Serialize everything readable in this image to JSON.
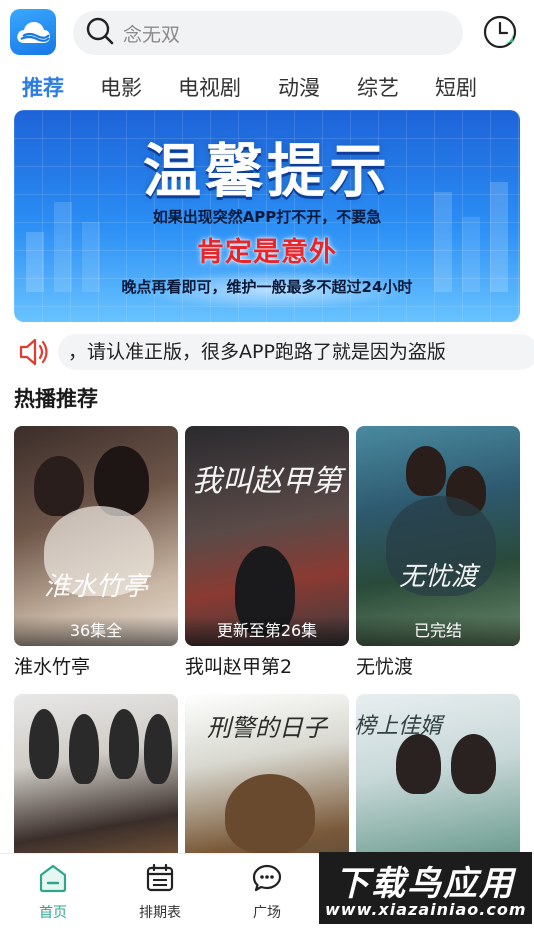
{
  "header": {
    "logo_icon": "cloud-logo-icon",
    "search": {
      "value": "念无双",
      "icon": "search-icon"
    },
    "history_icon": "clock-icon"
  },
  "tabs": [
    {
      "label": "推荐",
      "active": true
    },
    {
      "label": "电影",
      "active": false
    },
    {
      "label": "电视剧",
      "active": false
    },
    {
      "label": "动漫",
      "active": false
    },
    {
      "label": "综艺",
      "active": false
    },
    {
      "label": "短剧",
      "active": false
    }
  ],
  "banner": {
    "title": "温馨提示",
    "line1": "如果出现突然APP打不开，不要急",
    "line2": "肯定是意外",
    "line3": "晚点再看即可，维护一般最多不超过24小时"
  },
  "notice": {
    "icon": "speaker-icon",
    "text": "，请认准正版，很多APP跑路了就是因为盗版"
  },
  "section": {
    "title": "热播推荐"
  },
  "cards": [
    {
      "name": "淮水竹亭",
      "badge": "36集全",
      "poster_text": "淮水竹亭"
    },
    {
      "name": "我叫赵甲第2",
      "badge": "更新至第26集",
      "poster_text": "我叫赵甲第"
    },
    {
      "name": "无忧渡",
      "badge": "已完结",
      "poster_text": "无忧渡"
    },
    {
      "name": "",
      "badge": "",
      "poster_text": ""
    },
    {
      "name": "",
      "badge": "",
      "poster_text": "刑警的日子"
    },
    {
      "name": "",
      "badge": "",
      "poster_text": "榜上佳婿"
    }
  ],
  "bottom_nav": [
    {
      "label": "首页",
      "icon": "home-icon",
      "active": true
    },
    {
      "label": "排期表",
      "icon": "calendar-icon",
      "active": false
    },
    {
      "label": "广场",
      "icon": "chat-icon",
      "active": false
    }
  ],
  "watermark": {
    "line1": "下载鸟应用",
    "line2": "www.xiazainiao.com"
  },
  "colors": {
    "accent": "#2a7de1",
    "nav_active": "#2fa58c",
    "notice_icon": "#e33b2e"
  }
}
